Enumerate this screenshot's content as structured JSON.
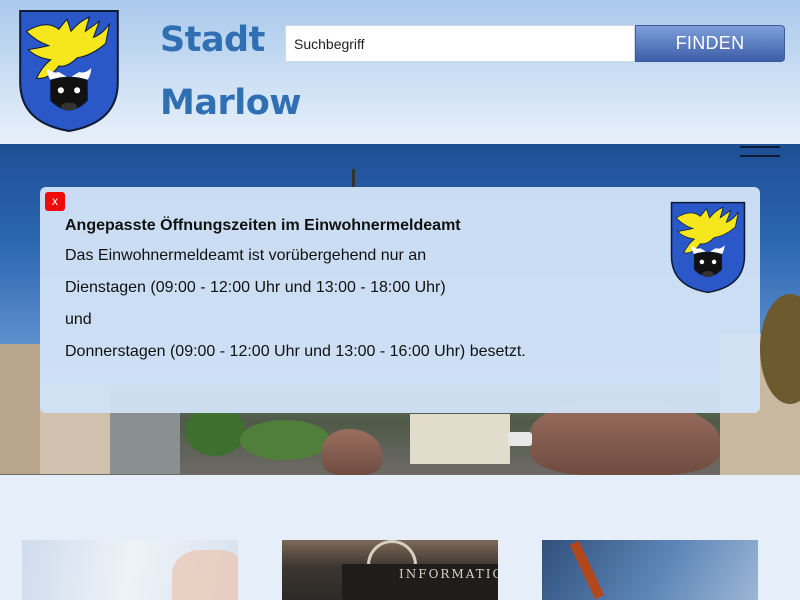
{
  "header": {
    "title_line1": "Stadt",
    "title_line2": "Marlow",
    "logo_icon": "marlow-coat-of-arms-icon"
  },
  "search": {
    "placeholder": "Suchbegriff",
    "button_label": "FINDEN"
  },
  "navigation": {
    "menu_icon": "hamburger-menu-icon"
  },
  "notice": {
    "close_label": "x",
    "title": "Angepasste Öffnungszeiten im Einwohnermeldeamt",
    "lines": [
      "Das Einwohnermeldeamt ist vorübergehend nur an",
      "Dienstagen (09:00 - 12:00 Uhr und 13:00 - 18:00 Uhr)",
      "und",
      "Donnerstagen (09:00 - 12:00 Uhr und 13:00 - 16:00 Uhr) besetzt."
    ]
  },
  "tiles": [
    {
      "image": "hand-touch-photo"
    },
    {
      "image": "information-desk-photo",
      "text": "INFORMATIO"
    },
    {
      "image": "pen-writing-photo"
    }
  ],
  "colors": {
    "title_blue": "#2f6fb2",
    "button_blue": "#3d5ea8",
    "close_red": "#ee0b0b",
    "coat_yellow": "#f6e71c",
    "coat_blue": "#2b58c9"
  }
}
